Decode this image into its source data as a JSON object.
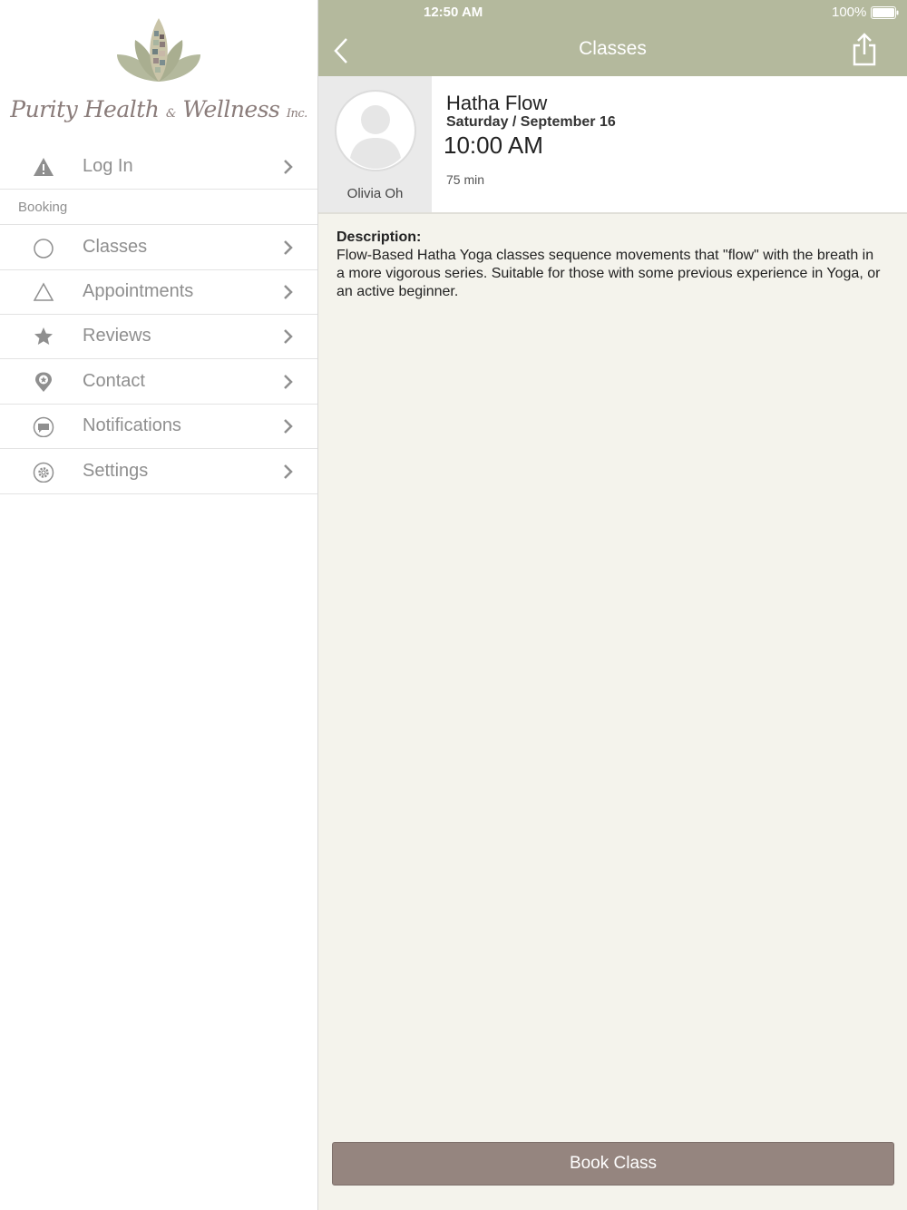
{
  "colors": {
    "nav_bar": "#b4b99d",
    "book_button": "#95857f",
    "main_background": "#f4f3ec",
    "menu_text": "#8f8f8f"
  },
  "sidebar": {
    "logo": {
      "brand_main": "Purity Health",
      "brand_amp": "&",
      "brand_second": "Wellness",
      "brand_suffix": "Inc."
    },
    "login": {
      "label": "Log In",
      "icon": "warning-icon"
    },
    "section_header": "Booking",
    "items": [
      {
        "label": "Classes",
        "icon": "circle-icon"
      },
      {
        "label": "Appointments",
        "icon": "triangle-icon"
      },
      {
        "label": "Reviews",
        "icon": "star-icon"
      },
      {
        "label": "Contact",
        "icon": "location-pin-icon"
      },
      {
        "label": "Notifications",
        "icon": "chat-bubble-icon"
      },
      {
        "label": "Settings",
        "icon": "gear-icon"
      }
    ]
  },
  "status_bar": {
    "time": "12:50 AM",
    "battery": "100%"
  },
  "nav": {
    "title": "Classes",
    "back_icon": "chevron-left-icon",
    "share_icon": "share-icon"
  },
  "class": {
    "instructor": "Olivia Oh",
    "name": "Hatha Flow",
    "date": "Saturday / September 16",
    "time": "10:00 AM",
    "duration": "75 min",
    "description_heading": "Description:",
    "description": "Flow-Based Hatha Yoga classes sequence movements that \"flow\" with the breath in a more vigorous series. Suitable for those with some previous experience in Yoga, or an active beginner."
  },
  "book_button": "Book Class"
}
